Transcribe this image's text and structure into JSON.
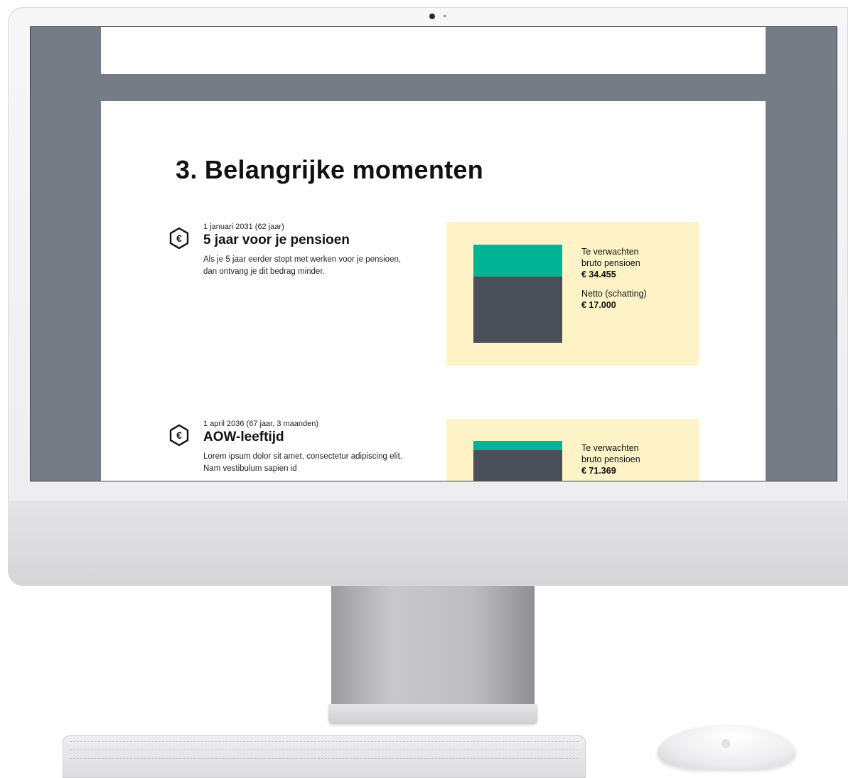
{
  "section": {
    "title": "3. Belangrijke momenten"
  },
  "moments": [
    {
      "date": "1 januari 2031 (62 jaar)",
      "title": "5 jaar voor je pensioen",
      "description": "Als je 5 jaar eerder stopt met werken voor je pensioen, dan ontvang je dit bedrag minder.",
      "icon": "euro-hexagon-icon",
      "card": {
        "gross_label_line1": "Te verwachten",
        "gross_label_line2": "bruto pensioen",
        "gross_value": "€ 34.455",
        "net_label": "Netto (schatting)",
        "net_value": "€ 17.000"
      }
    },
    {
      "date": "1 april 2036 (67 jaar, 3 maanden)",
      "title": "AOW-leeftijd",
      "description": "Lorem ipsum dolor sit amet, consectetur adipiscing elit. Nam vestibulum sapien id",
      "icon": "euro-hexagon-icon",
      "card": {
        "gross_label_line1": "Te verwachten",
        "gross_label_line2": "bruto pensioen",
        "gross_value": "€ 71.369"
      }
    }
  ],
  "colors": {
    "card_background": "#fdf3c6",
    "bar_accent": "#00b495",
    "bar_dark": "#4a5059",
    "screen_backdrop": "#767c85"
  }
}
